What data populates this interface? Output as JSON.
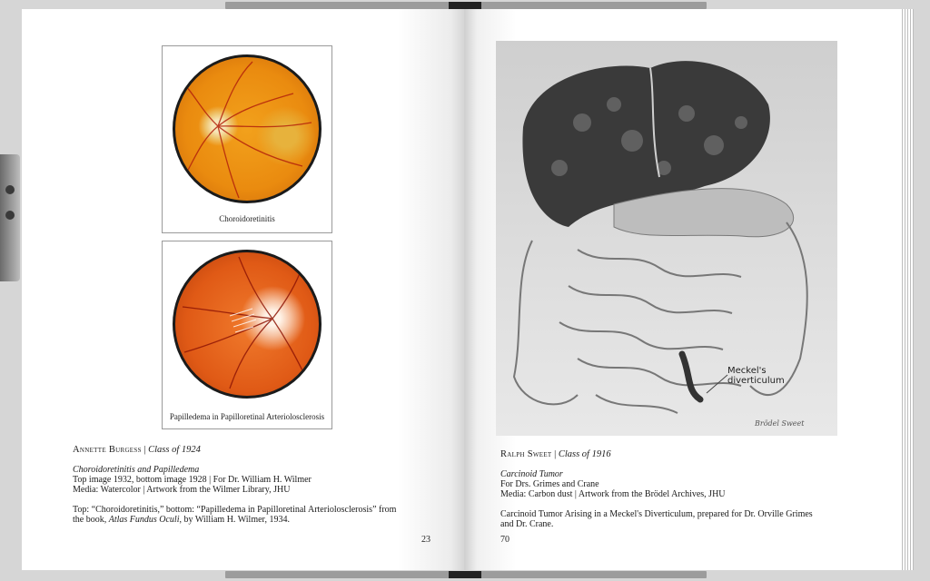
{
  "left_page": {
    "plates": [
      {
        "caption": "Choroidoretinitis"
      },
      {
        "caption": "Papilledema in Papilloretinal Arteriolosclerosis"
      }
    ],
    "artist_name": "Annette Burgess",
    "artist_class": "Class of 1924",
    "work_title": "Choroidoretinitis and Papilledema",
    "line1": "Top image 1932, bottom image 1928 | For Dr. William H. Wilmer",
    "line2": "Media: Watercolor | Artwork from the Wilmer Library, JHU",
    "desc_pre": "Top: “Choroidoretinitis,” bottom: “Papilledema in Papilloretinal Arteriolosclerosis” from",
    "desc_book_pre": "the book, ",
    "desc_book": "Atlas Fundus Oculi",
    "desc_book_post": ", by William H. Wilmer, 1934.",
    "page_number": "23"
  },
  "right_page": {
    "drawing_label": [
      "Meckel's",
      "diverticulum"
    ],
    "drawing_signature": "Brödel  Sweet",
    "artist_name": "Ralph Sweet",
    "artist_class": "Class of 1916",
    "work_title": "Carcinoid Tumor",
    "line1": "For Drs. Grimes and Crane",
    "line2": "Media: Carbon dust | Artwork from the Brödel Archives, JHU",
    "desc1": "Carcinoid Tumor Arising in a Meckel's Diverticulum, prepared for Dr. Orville Grimes",
    "desc2": "and Dr. Crane.",
    "page_number": "70"
  },
  "separator": "|"
}
